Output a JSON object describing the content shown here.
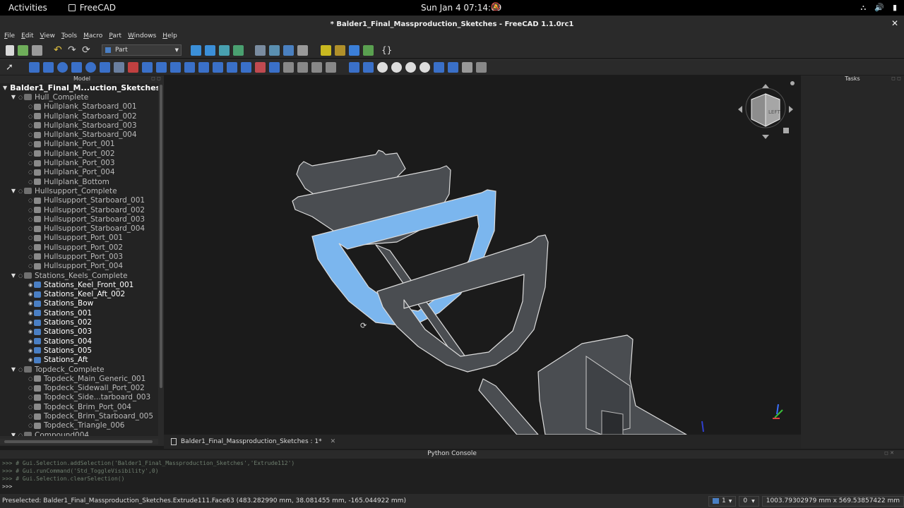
{
  "topbar": {
    "activities": "Activities",
    "app": "FreeCAD",
    "clock": "Sun Jan 4  07:14:09"
  },
  "window": {
    "title": "* Balder1_Final_Massproduction_Sketches - FreeCAD 1.1.0rc1"
  },
  "menu": [
    "File",
    "Edit",
    "View",
    "Tools",
    "Macro",
    "Part",
    "Windows",
    "Help"
  ],
  "toolbar": {
    "workbench": "Part"
  },
  "model_panel": {
    "title": "Model",
    "rows": [
      {
        "label": "Balder1_Final_M...uction_Sketches",
        "depth": 0,
        "type": "root"
      },
      {
        "label": "Hull_Complete",
        "depth": 1,
        "type": "group"
      },
      {
        "label": "Hullplank_Starboard_001",
        "depth": 2,
        "type": "part"
      },
      {
        "label": "Hullplank_Starboard_002",
        "depth": 2,
        "type": "part"
      },
      {
        "label": "Hullplank_Starboard_003",
        "depth": 2,
        "type": "part"
      },
      {
        "label": "Hullplank_Starboard_004",
        "depth": 2,
        "type": "part"
      },
      {
        "label": "Hullplank_Port_001",
        "depth": 2,
        "type": "part"
      },
      {
        "label": "Hullplank_Port_002",
        "depth": 2,
        "type": "part"
      },
      {
        "label": "Hullplank_Port_003",
        "depth": 2,
        "type": "part"
      },
      {
        "label": "Hullplank_Port_004",
        "depth": 2,
        "type": "part"
      },
      {
        "label": "Hullplank_Bottom",
        "depth": 2,
        "type": "part"
      },
      {
        "label": "Hullsupport_Complete",
        "depth": 1,
        "type": "group"
      },
      {
        "label": "Hullsupport_Starboard_001",
        "depth": 2,
        "type": "part"
      },
      {
        "label": "Hullsupport_Starboard_002",
        "depth": 2,
        "type": "part"
      },
      {
        "label": "Hullsupport_Starboard_003",
        "depth": 2,
        "type": "part"
      },
      {
        "label": "Hullsupport_Starboard_004",
        "depth": 2,
        "type": "part"
      },
      {
        "label": "Hullsupport_Port_001",
        "depth": 2,
        "type": "part"
      },
      {
        "label": "Hullsupport_Port_002",
        "depth": 2,
        "type": "part"
      },
      {
        "label": "Hullsupport_Port_003",
        "depth": 2,
        "type": "part"
      },
      {
        "label": "Hullsupport_Port_004",
        "depth": 2,
        "type": "part"
      },
      {
        "label": "Stations_Keels_Complete",
        "depth": 1,
        "type": "group"
      },
      {
        "label": "Stations_Keel_Front_001",
        "depth": 2,
        "type": "visible"
      },
      {
        "label": "Stations_Keel_Aft_002",
        "depth": 2,
        "type": "visible"
      },
      {
        "label": "Stations_Bow",
        "depth": 2,
        "type": "visible"
      },
      {
        "label": "Stations_001",
        "depth": 2,
        "type": "visible"
      },
      {
        "label": "Stations_002",
        "depth": 2,
        "type": "visible"
      },
      {
        "label": "Stations_003",
        "depth": 2,
        "type": "visible"
      },
      {
        "label": "Stations_004",
        "depth": 2,
        "type": "visible"
      },
      {
        "label": "Stations_005",
        "depth": 2,
        "type": "visible"
      },
      {
        "label": "Stations_Aft",
        "depth": 2,
        "type": "visible"
      },
      {
        "label": "Topdeck_Complete",
        "depth": 1,
        "type": "group"
      },
      {
        "label": "Topdeck_Main_Generic_001",
        "depth": 2,
        "type": "part"
      },
      {
        "label": "Topdeck_Sidewall_Port_002",
        "depth": 2,
        "type": "part"
      },
      {
        "label": "Topdeck_Side...tarboard_003",
        "depth": 2,
        "type": "part"
      },
      {
        "label": "Topdeck_Brim_Port_004",
        "depth": 2,
        "type": "part"
      },
      {
        "label": "Topdeck_Brim_Starboard_005",
        "depth": 2,
        "type": "part"
      },
      {
        "label": "Topdeck_Triangle_006",
        "depth": 2,
        "type": "part"
      },
      {
        "label": "Compound004",
        "depth": 1,
        "type": "group"
      }
    ]
  },
  "tasks_panel": {
    "title": "Tasks"
  },
  "doc_tab": {
    "label": "Balder1_Final_Massproduction_Sketches : 1*"
  },
  "console": {
    "title": "Python Console",
    "lines": [
      ">>> # Gui.Selection.addSelection('Balder1_Final_Massproduction_Sketches','Extrude112')",
      ">>> # Gui.runCommand('Std_ToggleVisibility',0)",
      ">>> # Gui.Selection.clearSelection()",
      ">>> "
    ]
  },
  "status": {
    "preselected": "Preselected: Balder1_Final_Massproduction_Sketches.Extrude111.Face63 (483.282990 mm, 38.081455 mm, -165.044922 mm)",
    "page_count": "1",
    "nav_value": "0",
    "dimensions": "1003.79302979 mm x 569.53857422 mm"
  },
  "navcube": {
    "face": "LEFT"
  },
  "colors": {
    "selection": "#7bb6ee",
    "part_grey": "#4a4d51",
    "background": "#1b1b1b"
  }
}
